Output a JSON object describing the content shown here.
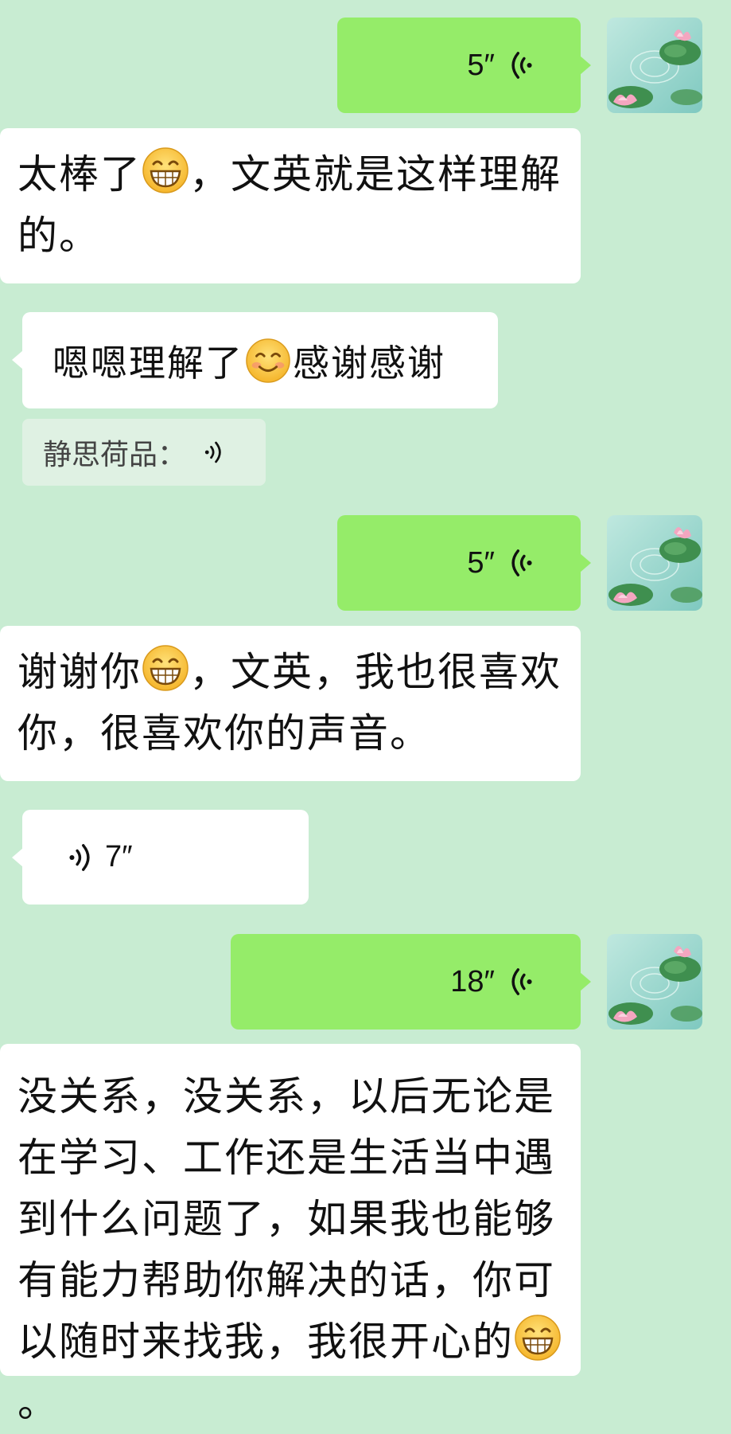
{
  "messages": {
    "voice1": {
      "duration": "5″",
      "icon": "voice-wave-icon"
    },
    "transcript1": {
      "text_a": "太棒了",
      "text_b": "，文英就是这样理解的。",
      "emoji": "grin-emoji"
    },
    "reply1": {
      "text_a": "嗯嗯理解了",
      "text_b": "感谢感谢",
      "emoji": "smile-emoji"
    },
    "quote1": {
      "label": "静思荷品：",
      "icon": "voice-wave-icon"
    },
    "voice2": {
      "duration": "5″",
      "icon": "voice-wave-icon"
    },
    "transcript2": {
      "text_a": "谢谢你",
      "text_b": "，文英，我也很喜欢你，很喜欢你的声音。",
      "emoji": "grin-emoji"
    },
    "voice_in": {
      "duration": "7″",
      "icon": "voice-wave-icon"
    },
    "voice3": {
      "duration": "18″",
      "icon": "voice-wave-icon"
    },
    "transcript3": {
      "text_a": "没关系，没关系，以后无论是在学习、工作还是生活当中遇到什么问题了，如果我也能够有能力帮助你解决的话，你可以随时来找我，我很开心的",
      "text_b": "。",
      "emoji": "grin-emoji"
    }
  },
  "colors": {
    "background": "#c8ecd2",
    "sent_bubble": "#95ec69",
    "received_bubble": "#ffffff",
    "quote_bg": "#dff1e3"
  }
}
